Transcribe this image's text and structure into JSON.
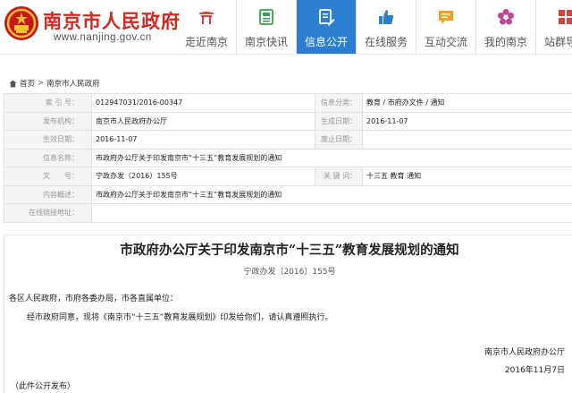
{
  "site": {
    "name": "南京市人民政府",
    "url": "www.nanjing.gov.cn"
  },
  "colors": {
    "brand_red": "#d7261e",
    "nav_active_blue": "#2c7fce"
  },
  "nav": [
    {
      "label": "走近南京",
      "icon": "city-gate-icon",
      "active": false
    },
    {
      "label": "南京快讯",
      "icon": "newspaper-icon",
      "active": false
    },
    {
      "label": "信息公开",
      "icon": "document-edit-icon",
      "active": true
    },
    {
      "label": "在线服务",
      "icon": "thumbs-up-icon",
      "active": false
    },
    {
      "label": "互动交流",
      "icon": "chat-bubble-icon",
      "active": false
    },
    {
      "label": "我的南京",
      "icon": "flower-icon",
      "active": false
    },
    {
      "label": "站群导航",
      "icon": "grid-icon",
      "active": false
    }
  ],
  "breadcrumb": {
    "home": "首页",
    "current": "南京市人民政府",
    "separator": ">"
  },
  "info": {
    "index_no_label": "索 引 号：",
    "index_no": "012947031/2016-00347",
    "category_label": "信息分类：",
    "category": "教育 / 市府办文件 / 通知",
    "issuer_label": "发布机构：",
    "issuer": "南京市人民政府办公厅",
    "created_label": "生成日期：",
    "created": "2016-11-07",
    "effective_label": "生效日期：",
    "effective": "2016-11-07",
    "abolished_label": "废止日期：",
    "abolished": "",
    "name_label": "信息名称：",
    "name": "市政府办公厅关于印发南京市“十三五”教育发展规划的通知",
    "docno_label": "文　　号：",
    "docno": "宁政办发（2016）155号",
    "keywords_label": "关 键 词：",
    "keywords": "十三五 教育 通知",
    "summary_label": "内容概述：",
    "summary": "市政府办公厅关于印发南京市“十三五”教育发展规划的通知",
    "link_label": "在线链接地址：",
    "link": ""
  },
  "document": {
    "title": "市政府办公厅关于印发南京市“十三五”教育发展规划的通知",
    "number": "宁政办发〔2016〕155号",
    "salutation": "各区人民政府，市府各委办局，市各直属单位：",
    "body": "经市政府同意，现将《南京市“十三五”教育发展规划》印发给你们，请认真遵照执行。",
    "signature": "南京市人民政府办公厅",
    "date": "2016年11月7日",
    "footnote": "（此件公开发布）"
  }
}
